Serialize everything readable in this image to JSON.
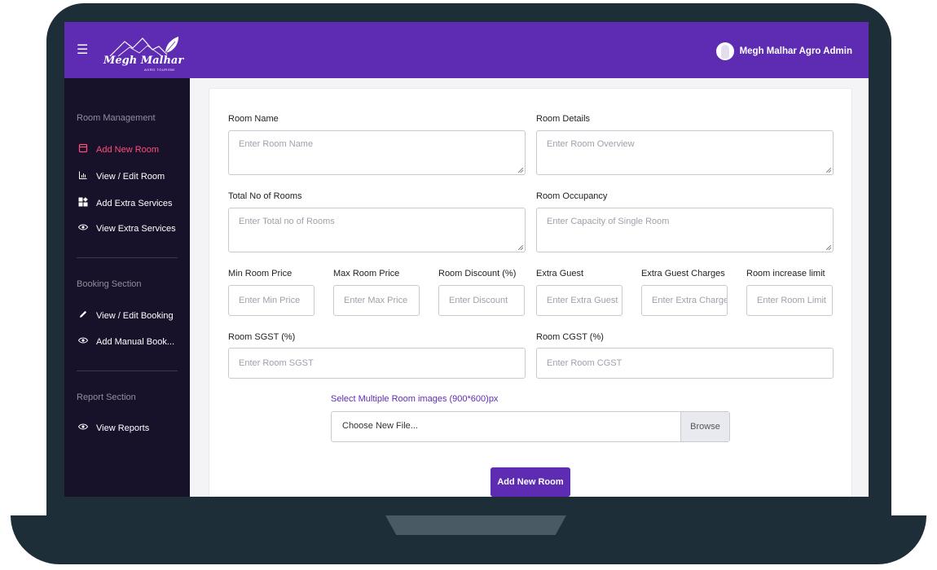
{
  "header": {
    "brand": "Megh Malhar",
    "brand_sub": "AGRO TOURISM",
    "user": "Megh Malhar Agro Admin"
  },
  "sidebar": {
    "sections": [
      {
        "title": "Room Management",
        "items": [
          {
            "label": "Add New Room",
            "icon": "calendar-icon",
            "active": true
          },
          {
            "label": "View / Edit Room",
            "icon": "bar-chart-icon"
          },
          {
            "label": "Add Extra Services",
            "icon": "grid-icon"
          },
          {
            "label": "View Extra Services",
            "icon": "eye-icon"
          }
        ]
      },
      {
        "title": "Booking Section",
        "items": [
          {
            "label": "View / Edit Booking",
            "icon": "pencil-icon"
          },
          {
            "label": "Add Manual Book...",
            "icon": "eye-icon"
          }
        ]
      },
      {
        "title": "Report Section",
        "items": [
          {
            "label": "View Reports",
            "icon": "eye-icon"
          }
        ]
      }
    ]
  },
  "form": {
    "room_name": {
      "label": "Room Name",
      "placeholder": "Enter Room Name"
    },
    "room_details": {
      "label": "Room Details",
      "placeholder": "Enter Room Overview"
    },
    "total_rooms": {
      "label": "Total No of Rooms",
      "placeholder": "Enter Total no of Rooms"
    },
    "occupancy": {
      "label": "Room Occupancy",
      "placeholder": "Enter Capacity of Single Room"
    },
    "min_price": {
      "label": "Min Room Price",
      "placeholder": "Enter Min Price"
    },
    "max_price": {
      "label": "Max Room Price",
      "placeholder": "Enter Max Price"
    },
    "discount": {
      "label": "Room Discount (%)",
      "placeholder": "Enter Discount"
    },
    "extra_guest": {
      "label": "Extra Guest",
      "placeholder": "Enter Extra Guest"
    },
    "extra_guest_charges": {
      "label": "Extra Guest Charges",
      "placeholder": "Enter Extra Charges"
    },
    "increase_limit": {
      "label": "Room increase limit",
      "placeholder": "Enter Room Limit"
    },
    "sgst": {
      "label": "Room SGST (%)",
      "placeholder": "Enter Room SGST"
    },
    "cgst": {
      "label": "Room CGST (%)",
      "placeholder": "Enter Room CGST"
    },
    "images": {
      "label": "Select Multiple Room images (900*600)px",
      "file_placeholder": "Choose New File...",
      "browse_label": "Browse"
    },
    "submit_label": "Add New Room"
  },
  "colors": {
    "header": "#5e2cb3",
    "sidebar": "#17112a",
    "active_nav": "#ff4f79",
    "laptop_frame": "#1d2e38"
  }
}
